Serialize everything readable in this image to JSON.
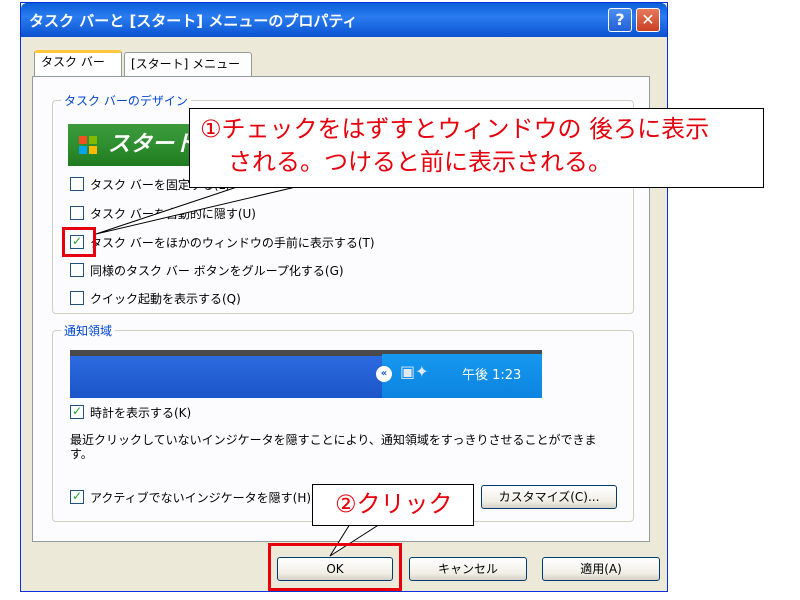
{
  "window": {
    "title": "タスク バーと [スタート] メニューのプロパティ",
    "help": "?",
    "close": "✕"
  },
  "tabs": [
    {
      "label": "タスク バー"
    },
    {
      "label": "[スタート] メニュー"
    }
  ],
  "taskbar_group": {
    "title": "タスク バーのデザイン",
    "start_label": "スタート",
    "options": [
      {
        "label": "タスク バーを固定する(L)",
        "checked": false
      },
      {
        "label": "タスク バーを自動的に隠す(U)",
        "checked": false
      },
      {
        "label": "タスク バーをほかのウィンドウの手前に表示する(T)",
        "checked": true
      },
      {
        "label": "同様のタスク バー ボタンをグループ化する(G)",
        "checked": false
      },
      {
        "label": "クイック起動を表示する(Q)",
        "checked": false
      }
    ]
  },
  "notify_group": {
    "title": "通知領域",
    "clock_preview": "午後 1:23",
    "show_clock": {
      "label": "時計を表示する(K)",
      "checked": true
    },
    "description": "最近クリックしていないインジケータを隠すことにより、通知領域をすっきりさせることができます。",
    "hide_inactive": {
      "label": "アクティブでないインジケータを隠す(H)",
      "checked": true
    },
    "customize_button": "カスタマイズ(C)..."
  },
  "buttons": {
    "ok": "OK",
    "cancel": "キャンセル",
    "apply": "適用(A)"
  },
  "annotations": {
    "callout1_line1": "①チェックをはずすとウィンドウの 後ろに表示",
    "callout1_line2": "される。つけると前に表示される。",
    "callout2": "②クリック"
  },
  "colors": {
    "highlight": "#e6000d",
    "group_title": "#0046d5"
  }
}
